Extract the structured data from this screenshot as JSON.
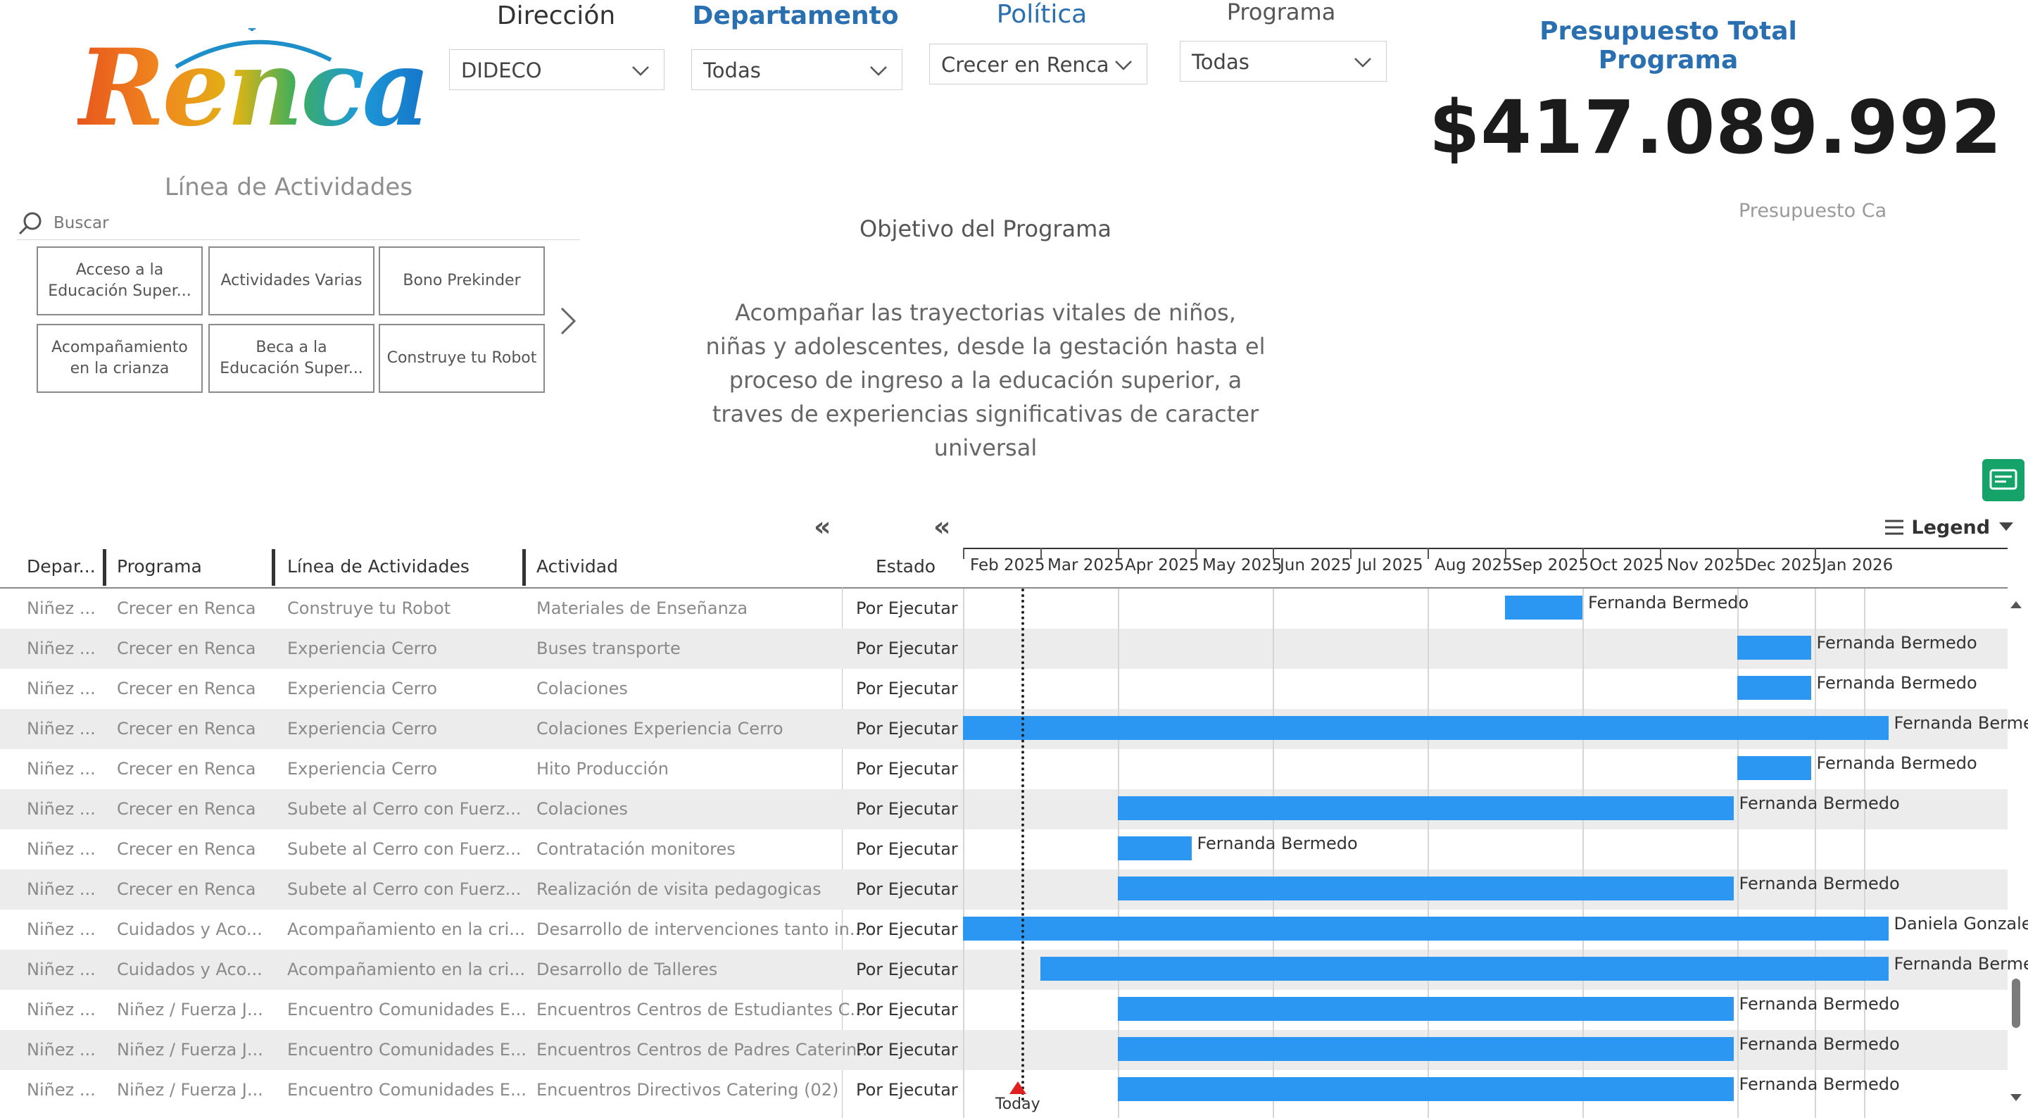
{
  "logo": {
    "text": "Renca"
  },
  "slicers": [
    {
      "title": "Dirección",
      "value": "DIDECO"
    },
    {
      "title": "Departamento",
      "value": "Todas"
    },
    {
      "title": "Política",
      "value": "Crecer en Renca"
    },
    {
      "title": "Programa",
      "value": "Todas"
    }
  ],
  "colors": {
    "accent": "#2a6fb0",
    "bar": "#2c97f2",
    "card_green": "#16a36a"
  },
  "budget": {
    "title": "Presupuesto Total Programa",
    "value": "$417.089.992",
    "subtitle": "Presupuesto Ca"
  },
  "linea": {
    "title": "Línea de Actividades",
    "search_placeholder": "Buscar",
    "chips": [
      "Acceso a la Educación Super...",
      "Actividades Varias",
      "Bono Prekinder",
      "Acompañamiento en la crianza",
      "Beca a la Educación Super...",
      "Construye tu Robot"
    ]
  },
  "objective": {
    "title": "Objetivo del Programa",
    "text": "Acompañar las trayectorias vitales de niños, niñas y adolescentes, desde la gestación hasta el proceso de ingreso a la educación superior, a traves de experiencias significativas de caracter universal"
  },
  "table": {
    "collapse_glyph": "«",
    "headers": [
      "Depar...",
      "Programa",
      "Línea de Actividades",
      "Actividad",
      "Estado"
    ],
    "rows": [
      {
        "dep": "Niñez ...",
        "prog": "Crecer en Renca",
        "linea": "Construye tu Robot",
        "act": "Materiales de Enseñanza",
        "estado": "Por Ejecutar",
        "start": 7.0,
        "end": 8.0,
        "owner": "Fernanda Bermedo"
      },
      {
        "dep": "Niñez ...",
        "prog": "Crecer en Renca",
        "linea": "Experiencia Cerro",
        "act": "Buses transporte",
        "estado": "Por Ejecutar",
        "start": 10.0,
        "end": 10.95,
        "owner": "Fernanda Bermedo"
      },
      {
        "dep": "Niñez ...",
        "prog": "Crecer en Renca",
        "linea": "Experiencia Cerro",
        "act": "Colaciones",
        "estado": "Por Ejecutar",
        "start": 10.0,
        "end": 10.95,
        "owner": "Fernanda Bermedo"
      },
      {
        "dep": "Niñez ...",
        "prog": "Crecer en Renca",
        "linea": "Experiencia Cerro",
        "act": "Colaciones Experiencia Cerro",
        "estado": "Por Ejecutar",
        "start": 0.0,
        "end": 11.95,
        "owner": "Fernanda Bermedo"
      },
      {
        "dep": "Niñez ...",
        "prog": "Crecer en Renca",
        "linea": "Experiencia Cerro",
        "act": "Hito Producción",
        "estado": "Por Ejecutar",
        "start": 10.0,
        "end": 10.95,
        "owner": "Fernanda Bermedo"
      },
      {
        "dep": "Niñez ...",
        "prog": "Crecer en Renca",
        "linea": "Subete al Cerro con Fuerz...",
        "act": "Colaciones",
        "estado": "Por Ejecutar",
        "start": 2.0,
        "end": 9.95,
        "owner": "Fernanda Bermedo"
      },
      {
        "dep": "Niñez ...",
        "prog": "Crecer en Renca",
        "linea": "Subete al Cerro con Fuerz...",
        "act": "Contratación monitores",
        "estado": "Por Ejecutar",
        "start": 2.0,
        "end": 2.95,
        "owner": "Fernanda Bermedo"
      },
      {
        "dep": "Niñez ...",
        "prog": "Crecer en Renca",
        "linea": "Subete al Cerro con Fuerz...",
        "act": "Realización de visita pedagogicas",
        "estado": "Por Ejecutar",
        "start": 2.0,
        "end": 9.95,
        "owner": "Fernanda Bermedo"
      },
      {
        "dep": "Niñez ...",
        "prog": "Cuidados y Aco...",
        "linea": "Acompañamiento en la cri...",
        "act": "Desarrollo de intervenciones tanto in...",
        "estado": "Por Ejecutar",
        "start": 0.0,
        "end": 11.95,
        "owner": "Daniela Gonzalez"
      },
      {
        "dep": "Niñez ...",
        "prog": "Cuidados y Aco...",
        "linea": "Acompañamiento en la cri...",
        "act": "Desarrollo de Talleres",
        "estado": "Por Ejecutar",
        "start": 1.0,
        "end": 11.95,
        "owner": "Fernanda Bermedo"
      },
      {
        "dep": "Niñez ...",
        "prog": "Niñez / Fuerza J...",
        "linea": "Encuentro Comunidades E...",
        "act": "Encuentros Centros de Estudiantes C...",
        "estado": "Por Ejecutar",
        "start": 2.0,
        "end": 9.95,
        "owner": "Fernanda Bermedo"
      },
      {
        "dep": "Niñez ...",
        "prog": "Niñez / Fuerza J...",
        "linea": "Encuentro Comunidades E...",
        "act": "Encuentros Centros de Padres Caterin...",
        "estado": "Por Ejecutar",
        "start": 2.0,
        "end": 9.95,
        "owner": "Fernanda Bermedo"
      },
      {
        "dep": "Niñez ...",
        "prog": "Niñez / Fuerza J...",
        "linea": "Encuentro Comunidades E...",
        "act": "Encuentros Directivos Catering (02)",
        "estado": "Por Ejecutar",
        "start": 2.0,
        "end": 9.95,
        "owner": "Fernanda Bermedo"
      }
    ]
  },
  "gantt": {
    "months": [
      "Feb 2025",
      "Mar 2025",
      "Apr 2025",
      "May 2025",
      "Jun 2025",
      "Jul 2025",
      "Aug 2025",
      "Sep 2025",
      "Oct 2025",
      "Nov 2025",
      "Dec 2025",
      "Jan 2026"
    ],
    "legend_label": "Legend",
    "today_label": "Today",
    "today_pos": 0.75
  }
}
